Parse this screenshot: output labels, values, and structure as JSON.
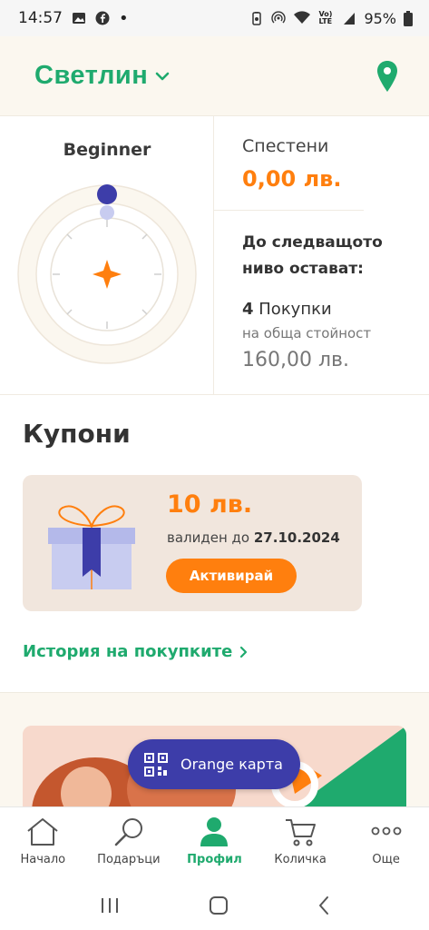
{
  "status_bar": {
    "time": "14:57",
    "battery": "95%",
    "icons": [
      "image-icon",
      "facebook-icon",
      "dot-icon",
      "battery-saver-icon",
      "hotspot-icon",
      "wifi-icon",
      "volte-icon",
      "signal-icon",
      "battery-icon"
    ],
    "volte_label": "Vo) LTE"
  },
  "header": {
    "store_name": "Светлин",
    "icons": [
      "chevron-down-icon",
      "location-pin-icon"
    ]
  },
  "level": {
    "title": "Beginner",
    "progress_fraction": 0,
    "saved_label": "Спестени",
    "saved_value": "0,00 лв.",
    "next_level_text": "До следващото ниво остават:",
    "purchases_count": "4",
    "purchases_label": "Покупки",
    "total_label": "на обща стойност",
    "total_value": "160,00 лв."
  },
  "coupons": {
    "title": "Купони",
    "items": [
      {
        "value": "10 лв.",
        "valid_prefix": "валиден до",
        "valid_date": "27.10.2024",
        "button_label": "Активирай"
      }
    ]
  },
  "history_link": "История на покупките",
  "card_button": "Orange карта",
  "bottom_nav": {
    "items": [
      {
        "label": "Начало",
        "icon": "home-icon"
      },
      {
        "label": "Подаръци",
        "icon": "search-icon"
      },
      {
        "label": "Профил",
        "icon": "profile-icon",
        "active": true
      },
      {
        "label": "Количка",
        "icon": "cart-icon"
      },
      {
        "label": "Още",
        "icon": "more-icon"
      }
    ]
  },
  "colors": {
    "green": "#1faa6e",
    "orange": "#ff7f0e",
    "indigo": "#3d3da9",
    "cream": "#fbf7ef"
  }
}
